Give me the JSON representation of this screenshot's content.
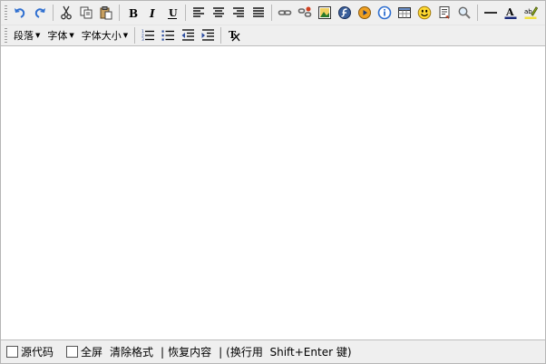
{
  "toolbar": {
    "row1_icons": [
      "undo-icon",
      "redo-icon",
      "cut-icon",
      "copy-icon",
      "paste-icon",
      "bold-icon",
      "italic-icon",
      "underline-icon",
      "align-left-icon",
      "align-center-icon",
      "align-right-icon",
      "align-justify-icon",
      "link-icon",
      "unlink-icon",
      "image-icon",
      "flash-icon",
      "media-icon",
      "info-icon",
      "table-icon",
      "emoticon-icon",
      "template-icon",
      "find-icon",
      "horizontal-rule-icon",
      "font-color-icon",
      "highlight-icon"
    ],
    "paragraph_label": "段落",
    "font_label": "字体",
    "font_size_label": "字体大小",
    "row2_icons": [
      "ordered-list-icon",
      "unordered-list-icon",
      "outdent-icon",
      "indent-icon",
      "remove-format-icon"
    ]
  },
  "status": {
    "source_label": "源代码",
    "fullscreen_label": "全屏",
    "clear_format_label": "清除格式",
    "pipe": "|",
    "restore_label": "恢复内容",
    "hint_text": "(换行用  Shift+Enter 键)"
  },
  "colors": {
    "toolbar_bg": "#efefef",
    "border": "#b6b6b6",
    "icon_blue": "#2f6fd0"
  }
}
